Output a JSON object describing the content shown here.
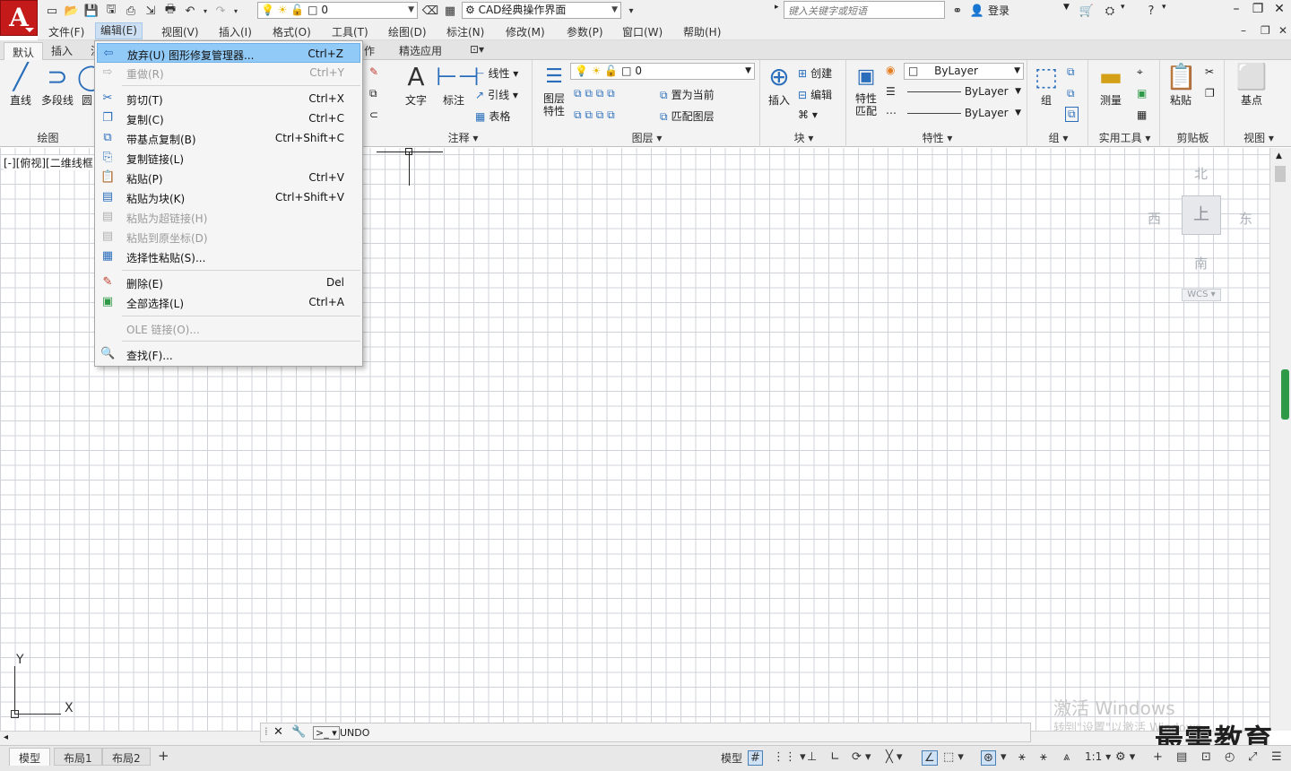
{
  "titlebar": {
    "logo": "A",
    "layer_value": "0",
    "workspace": "CAD经典操作界面",
    "search_placeholder": "键入关键字或短语",
    "login": "登录"
  },
  "menubar": [
    "文件(F)",
    "编辑(E)",
    "视图(V)",
    "插入(I)",
    "格式(O)",
    "工具(T)",
    "绘图(D)",
    "标注(N)",
    "修改(M)",
    "参数(P)",
    "窗口(W)",
    "帮助(H)"
  ],
  "ribbon_tabs": [
    "默认",
    "插入",
    "注",
    "作",
    "精选应用"
  ],
  "ribbon": {
    "draw": {
      "line": "直线",
      "polyline": "多段线",
      "circle": "圆",
      "title": "绘图"
    },
    "annotation": {
      "text": "文字",
      "dimension": "标注",
      "linear": "线性",
      "leader": "引线",
      "table": "表格",
      "title": "注释"
    },
    "layers": {
      "props": "图层\n特性",
      "props_line1": "图层",
      "props_line2": "特性",
      "layer_value": "0",
      "set_current": "置为当前",
      "match_layer": "匹配图层",
      "title": "图层"
    },
    "block": {
      "insert": "插入",
      "create": "创建",
      "edit": "编辑",
      "title": "块"
    },
    "properties": {
      "match_line1": "特性",
      "match_line2": "匹配",
      "color": "ByLayer",
      "linetype": "ByLayer",
      "lineweight": "ByLayer",
      "title": "特性"
    },
    "groups": {
      "group": "组",
      "title": "组"
    },
    "utilities": {
      "measure": "测量",
      "title": "实用工具"
    },
    "clipboard": {
      "paste": "粘贴",
      "title": "剪贴板"
    },
    "view": {
      "base": "基点",
      "title": "视图"
    }
  },
  "edit_menu": {
    "items": [
      {
        "label": "放弃(U) 图形修复管理器...",
        "shortcut": "Ctrl+Z",
        "icon": "undo-icon",
        "glyph": "⇦",
        "state": "highlight"
      },
      {
        "label": "重做(R)",
        "shortcut": "Ctrl+Y",
        "icon": "redo-icon",
        "glyph": "⇨",
        "state": "disabled"
      },
      {
        "label": "剪切(T)",
        "shortcut": "Ctrl+X",
        "icon": "cut-icon",
        "glyph": "✂",
        "state": "normal"
      },
      {
        "label": "复制(C)",
        "shortcut": "Ctrl+C",
        "icon": "copy-icon",
        "glyph": "❐",
        "state": "normal"
      },
      {
        "label": "带基点复制(B)",
        "shortcut": "Ctrl+Shift+C",
        "icon": "copy-basepoint-icon",
        "glyph": "⧉",
        "state": "normal"
      },
      {
        "label": "复制链接(L)",
        "shortcut": "",
        "icon": "copy-link-icon",
        "glyph": "⎘",
        "state": "normal"
      },
      {
        "label": "粘贴(P)",
        "shortcut": "Ctrl+V",
        "icon": "paste-icon",
        "glyph": "📋",
        "state": "normal"
      },
      {
        "label": "粘贴为块(K)",
        "shortcut": "Ctrl+Shift+V",
        "icon": "paste-block-icon",
        "glyph": "▤",
        "state": "normal"
      },
      {
        "label": "粘贴为超链接(H)",
        "shortcut": "",
        "icon": "paste-hyperlink-icon",
        "glyph": "▤",
        "state": "disabled"
      },
      {
        "label": "粘贴到原坐标(D)",
        "shortcut": "",
        "icon": "paste-orig-icon",
        "glyph": "▤",
        "state": "disabled"
      },
      {
        "label": "选择性粘贴(S)...",
        "shortcut": "",
        "icon": "paste-special-icon",
        "glyph": "▦",
        "state": "normal"
      },
      {
        "label": "删除(E)",
        "shortcut": "Del",
        "icon": "erase-icon",
        "glyph": "✎",
        "state": "normal"
      },
      {
        "label": "全部选择(L)",
        "shortcut": "Ctrl+A",
        "icon": "select-all-icon",
        "glyph": "▣",
        "state": "normal"
      },
      {
        "label": "OLE 链接(O)...",
        "shortcut": "",
        "icon": "",
        "glyph": "",
        "state": "disabled"
      },
      {
        "label": "查找(F)...",
        "shortcut": "",
        "icon": "find-icon",
        "glyph": "🔍",
        "state": "normal"
      }
    ]
  },
  "drawing": {
    "view_label": "[-][俯视][二维线框]",
    "viewcube": {
      "north": "北",
      "south": "南",
      "east": "东",
      "west": "西",
      "top": "上",
      "wcs": "WCS"
    },
    "ucs": {
      "x": "X",
      "y": "Y"
    }
  },
  "command_line": {
    "text": "UNDO"
  },
  "watermark": {
    "line1": "激活 Windows",
    "line2": "转到\"设置\"以激活 Windows。"
  },
  "brand": "最需教育",
  "layout_tabs": [
    "模型",
    "布局1",
    "布局2"
  ],
  "status": {
    "model": "模型",
    "scale": "1:1"
  },
  "colors": {
    "accent": "#2a6ebb",
    "highlight": "#91c9f7",
    "logo": "#c51a1a"
  }
}
